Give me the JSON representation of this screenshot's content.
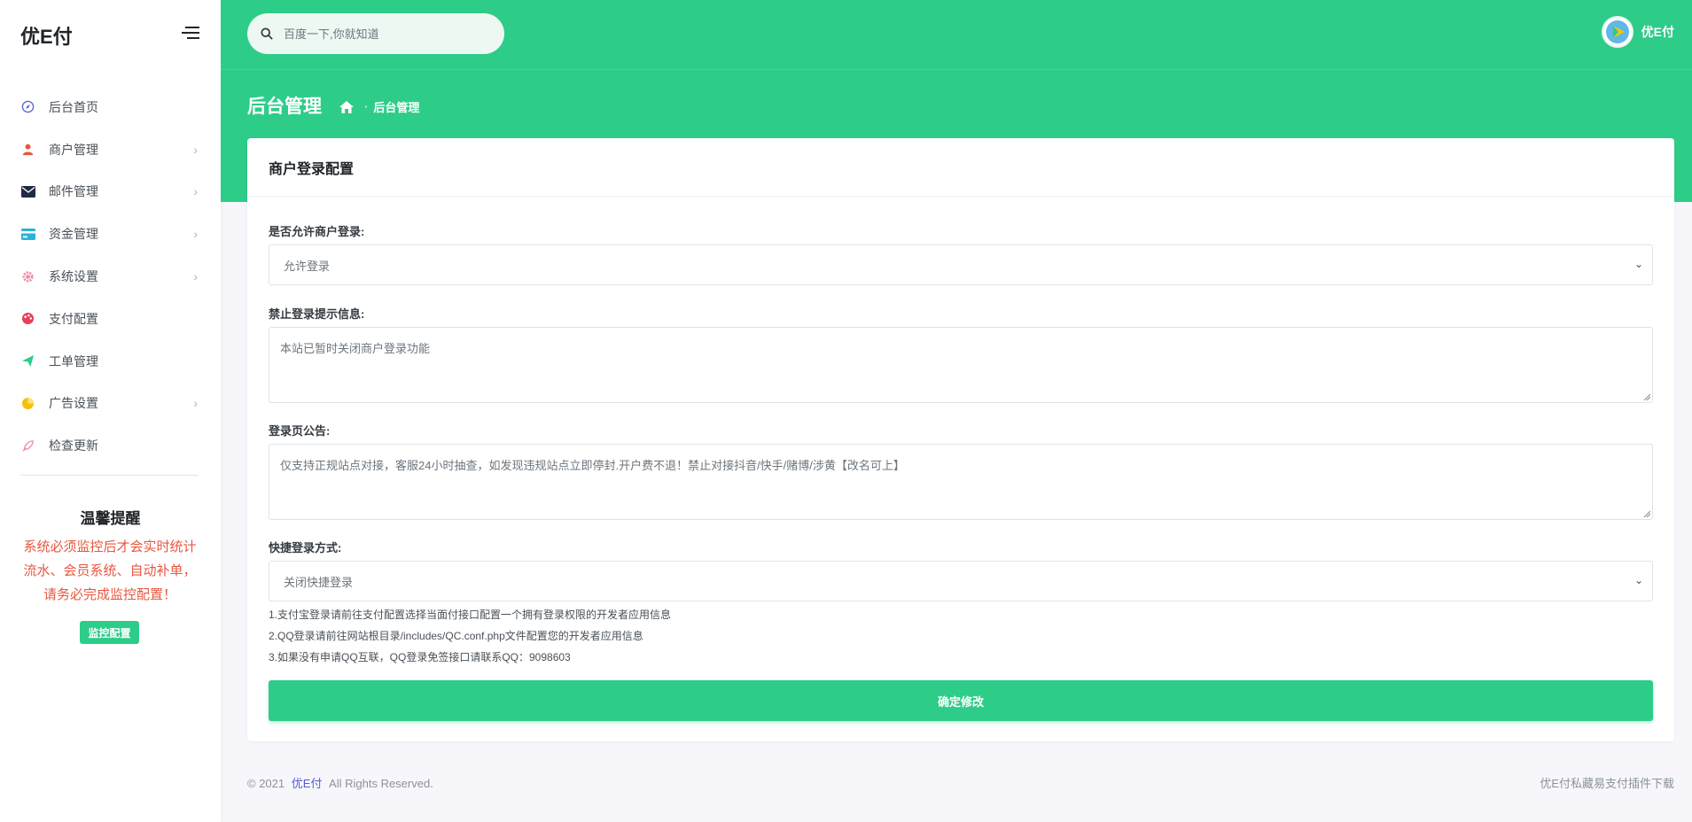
{
  "sidebar": {
    "brand": "优E付",
    "items": [
      {
        "label": "后台首页",
        "icon": "compass-icon",
        "color": "#5b6ad8",
        "chevron": false
      },
      {
        "label": "商户管理",
        "icon": "user-icon",
        "color": "#e8573f",
        "chevron": true
      },
      {
        "label": "邮件管理",
        "icon": "mail-icon",
        "color": "#1f2a44",
        "chevron": true
      },
      {
        "label": "资金管理",
        "icon": "card-icon",
        "color": "#2bb3d9",
        "chevron": true
      },
      {
        "label": "系统设置",
        "icon": "gear-icon",
        "color": "#f08aa3",
        "chevron": true
      },
      {
        "label": "支付配置",
        "icon": "palette-icon",
        "color": "#e8405a",
        "chevron": false
      },
      {
        "label": "工单管理",
        "icon": "send-icon",
        "color": "#2ecc89",
        "chevron": false
      },
      {
        "label": "广告设置",
        "icon": "pie-icon",
        "color": "#f4c20d",
        "chevron": true
      },
      {
        "label": "检查更新",
        "icon": "rocket-icon",
        "color": "#f08aa3",
        "chevron": false
      }
    ],
    "tip": {
      "title": "温馨提醒",
      "text": "系统必须监控后才会实时统计流水、会员系统、自动补单，请务必完成监控配置！",
      "button": "监控配置"
    }
  },
  "topbar": {
    "search_placeholder": "百度一下,你就知道",
    "username": "优E付"
  },
  "header": {
    "title": "后台管理",
    "breadcrumb": "后台管理"
  },
  "card": {
    "title": "商户登录配置",
    "allow_login": {
      "label": "是否允许商户登录:",
      "value": "允许登录"
    },
    "forbid_msg": {
      "label": "禁止登录提示信息:",
      "value": "本站已暂时关闭商户登录功能"
    },
    "notice": {
      "label": "登录页公告:",
      "value": "仅支持正规站点对接，客服24小时抽查，如发现违规站点立即停封.开户费不退！禁止对接抖音/快手/赌博/涉黄【改名可上】"
    },
    "quick_login": {
      "label": "快捷登录方式:",
      "value": "关闭快捷登录"
    },
    "hints": [
      "1.支付宝登录请前往支付配置选择当面付接口配置一个拥有登录权限的开发者应用信息",
      "2.QQ登录请前往网站根目录/includes/QC.conf.php文件配置您的开发者应用信息",
      "3.如果没有申请QQ互联，QQ登录免签接口请联系QQ：9098603"
    ],
    "submit": "确定修改"
  },
  "footer": {
    "copyright_prefix": "© 2021",
    "brand": "优E付",
    "copyright_suffix": "All Rights Reserved.",
    "right_text": "优E付私藏易支付插件下载"
  },
  "colors": {
    "accent": "#2ecc89",
    "warning_text": "#e8573f"
  }
}
